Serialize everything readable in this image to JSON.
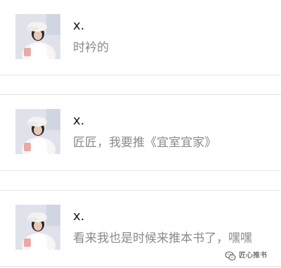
{
  "comments": [
    {
      "username": "x.",
      "text": "时衿的"
    },
    {
      "username": "x.",
      "text": "匠匠，我要推《宜室宜家》"
    },
    {
      "username": "x.",
      "text": "看来我也是时候来推本书了，嘿嘿"
    }
  ],
  "watermark": {
    "text": "匠心推书",
    "icon": "wechat-icon"
  },
  "colors": {
    "divider": "#e5e5e5",
    "username": "#1a1a1a",
    "text": "#8a8a8a"
  }
}
